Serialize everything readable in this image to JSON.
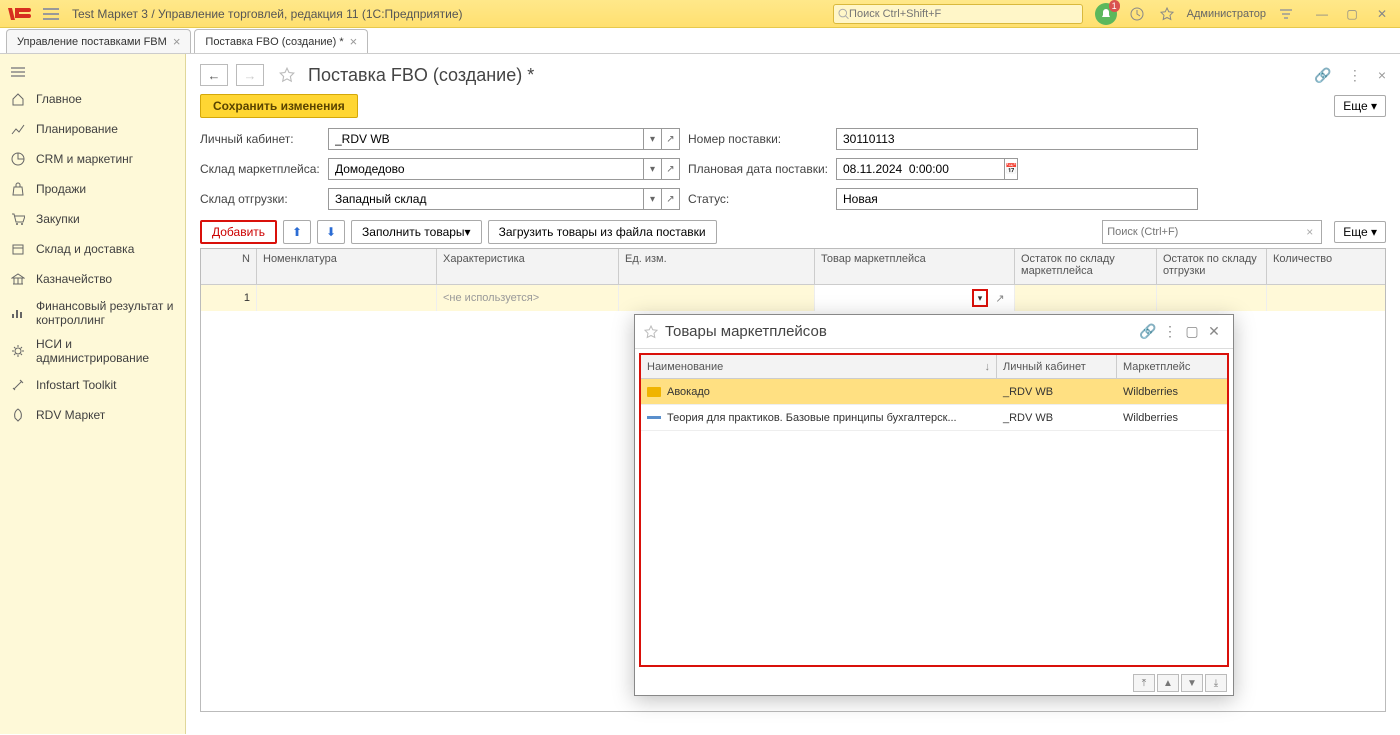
{
  "title": "Test Маркет 3 / Управление торговлей, редакция 11  (1С:Предприятие)",
  "top_search_placeholder": "Поиск Ctrl+Shift+F",
  "bell_badge": "1",
  "admin": "Администратор",
  "tabs": [
    {
      "label": "Управление поставками FBM"
    },
    {
      "label": "Поставка FBO (создание) *"
    }
  ],
  "sidebar": [
    {
      "label": "Главное",
      "icon": "home"
    },
    {
      "label": "Планирование",
      "icon": "chart"
    },
    {
      "label": "CRM и маркетинг",
      "icon": "pie"
    },
    {
      "label": "Продажи",
      "icon": "bag"
    },
    {
      "label": "Закупки",
      "icon": "cart"
    },
    {
      "label": "Склад и доставка",
      "icon": "box"
    },
    {
      "label": "Казначейство",
      "icon": "bank"
    },
    {
      "label": "Финансовый результат и контроллинг",
      "icon": "bars",
      "tall": true
    },
    {
      "label": "НСИ и администрирование",
      "icon": "gear",
      "tall": true
    },
    {
      "label": "Infostart Toolkit",
      "icon": "tools"
    },
    {
      "label": "RDV Маркет",
      "icon": "rocket"
    }
  ],
  "doc_title": "Поставка FBO (создание) *",
  "save_label": "Сохранить изменения",
  "more_label": "Еще",
  "form": {
    "lk_label": "Личный кабинет:",
    "lk_val": "_RDV WB",
    "np_label": "Номер поставки:",
    "np_val": "30110113",
    "smp_label": "Склад маркетплейса:",
    "smp_val": "Домодедово",
    "pdp_label": "Плановая дата поставки:",
    "pdp_val": "08.11.2024  0:00:00",
    "so_label": "Склад отгрузки:",
    "so_val": "Западный склад",
    "st_label": "Статус:",
    "st_val": "Новая"
  },
  "toolbar": {
    "add": "Добавить",
    "fill": "Заполнить товары",
    "load": "Загрузить товары из файла поставки",
    "search_placeholder": "Поиск (Ctrl+F)"
  },
  "grid_headers": {
    "n": "N",
    "nom": "Номенклатура",
    "char": "Характеристика",
    "ed": "Ед. изм.",
    "tov": "Товар маркетплейса",
    "ost1": "Остаток по складу маркетплейса",
    "ost2": "Остаток по складу отгрузки",
    "qty": "Количество"
  },
  "grid_row": {
    "n": "1",
    "char": "<не используется>"
  },
  "popup": {
    "title": "Товары маркетплейсов",
    "headers": {
      "name": "Наименование",
      "lk": "Личный кабинет",
      "mp": "Маркетплейс"
    },
    "rows": [
      {
        "name": "Авокадо",
        "lk": "_RDV WB",
        "mp": "Wildberries",
        "selected": true,
        "folder": true
      },
      {
        "name": "Теория для практиков. Базовые принципы бухгалтерск...",
        "lk": "_RDV WB",
        "mp": "Wildberries",
        "selected": false,
        "folder": false
      }
    ]
  }
}
